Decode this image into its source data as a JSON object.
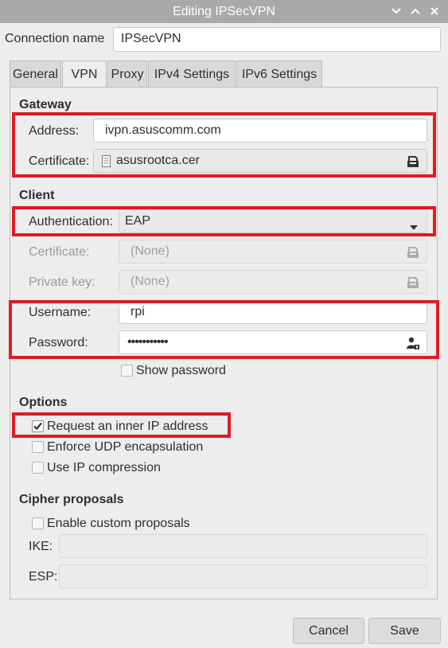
{
  "window": {
    "title": "Editing IPSecVPN"
  },
  "connection": {
    "label": "Connection name",
    "value": "IPSecVPN"
  },
  "tabs": [
    {
      "label": "General"
    },
    {
      "label": "VPN"
    },
    {
      "label": "Proxy"
    },
    {
      "label": "IPv4 Settings"
    },
    {
      "label": "IPv6 Settings"
    }
  ],
  "gateway": {
    "heading": "Gateway",
    "address_label": "Address:",
    "address_value": "ivpn.asuscomm.com",
    "certificate_label": "Certificate:",
    "certificate_value": "asusrootca.cer"
  },
  "client": {
    "heading": "Client",
    "auth_label": "Authentication:",
    "auth_value": "EAP",
    "certificate_label": "Certificate:",
    "certificate_value": "(None)",
    "private_key_label": "Private key:",
    "private_key_value": "(None)",
    "username_label": "Username:",
    "username_value": "rpi",
    "password_label": "Password:",
    "password_value": "•••••••••••",
    "show_password_label": "Show password"
  },
  "options": {
    "heading": "Options",
    "items": [
      {
        "label": "Request an inner IP address",
        "checked": true
      },
      {
        "label": "Enforce UDP encapsulation",
        "checked": false
      },
      {
        "label": "Use IP compression",
        "checked": false
      }
    ]
  },
  "cipher": {
    "heading": "Cipher proposals",
    "enable_label": "Enable custom proposals",
    "ike_label": "IKE:",
    "ike_value": "",
    "esp_label": "ESP:",
    "esp_value": ""
  },
  "buttons": {
    "cancel": "Cancel",
    "save": "Save"
  },
  "colors": {
    "highlight": "#e01b24",
    "titlebar": "#a9a9a9"
  }
}
